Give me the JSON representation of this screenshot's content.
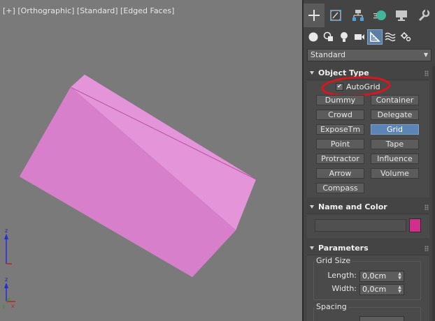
{
  "viewport": {
    "labels": [
      "[+]",
      "[Orthographic]",
      "[Standard]",
      "[Edged Faces]"
    ],
    "axis": {
      "z": "z",
      "x": "x",
      "y": "y"
    },
    "object_color": "#e08ad4"
  },
  "command_panel": {
    "tabs": [
      "create-icon",
      "modify-icon",
      "hierarchy-icon",
      "motion-icon",
      "display-icon",
      "utilities-icon"
    ],
    "sub_categories": [
      "geometry-icon",
      "shapes-icon",
      "lights-icon",
      "cameras-icon",
      "helpers-icon",
      "space-warps-icon",
      "systems-icon"
    ],
    "dropdown": {
      "value": "Standard"
    },
    "object_type": {
      "title": "Object Type",
      "autogrid_label": "AutoGrid",
      "autogrid_checked": true,
      "buttons": [
        "Dummy",
        "Container",
        "Crowd",
        "Delegate",
        "ExposeTm",
        "Grid",
        "Point",
        "Tape",
        "Protractor",
        "Influence",
        "Arrow",
        "Volume",
        "Compass"
      ],
      "selected": "Grid"
    },
    "name_color": {
      "title": "Name and Color",
      "name_value": "",
      "color": "#d0308c"
    },
    "parameters": {
      "title": "Parameters",
      "grid_size": {
        "title": "Grid Size",
        "length_label": "Length:",
        "length_value": "0,0cm",
        "width_label": "Width:",
        "width_value": "0,0cm"
      },
      "spacing": {
        "title": "Spacing"
      }
    },
    "accent": "#5c84b4",
    "highlight_color": "#d9161c"
  }
}
